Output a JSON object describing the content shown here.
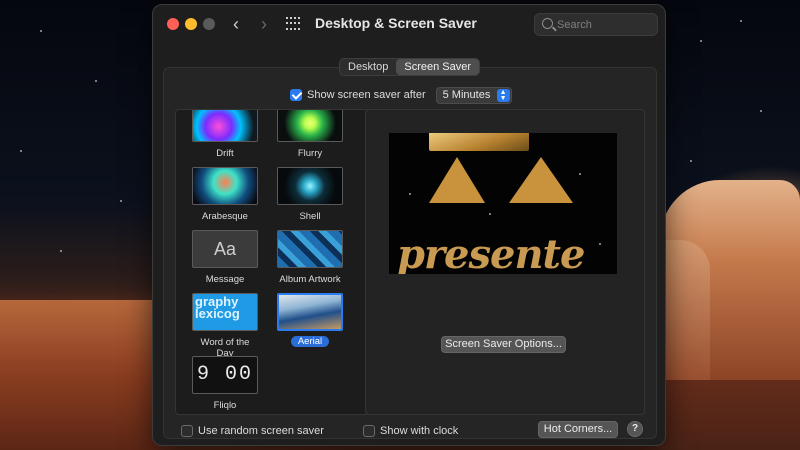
{
  "window": {
    "title": "Desktop & Screen Saver",
    "search_placeholder": "Search"
  },
  "tabs": [
    {
      "label": "Desktop",
      "active": false
    },
    {
      "label": "Screen Saver",
      "active": true
    }
  ],
  "show_after": {
    "label": "Show screen saver after",
    "checked": true,
    "value": "5 Minutes"
  },
  "screensavers": [
    {
      "name": "Drift",
      "icon": "drift-thumbnail"
    },
    {
      "name": "Flurry",
      "icon": "flurry-thumbnail"
    },
    {
      "name": "Arabesque",
      "icon": "arabesque-thumbnail"
    },
    {
      "name": "Shell",
      "icon": "shell-thumbnail"
    },
    {
      "name": "Message",
      "icon": "message-thumbnail",
      "thumb_text": "Aa"
    },
    {
      "name": "Album Artwork",
      "icon": "album-artwork-thumbnail"
    },
    {
      "name": "Word of the Day",
      "icon": "word-of-the-day-thumbnail",
      "thumb_text": "graphy lexicog"
    },
    {
      "name": "Aerial",
      "icon": "aerial-thumbnail",
      "selected": true
    },
    {
      "name": "Fliqlo",
      "icon": "fliqlo-thumbnail",
      "thumb_text": "9 00"
    }
  ],
  "preview": {
    "text": "presente"
  },
  "options_button": "Screen Saver Options...",
  "bottom": {
    "random_label": "Use random screen saver",
    "random_checked": false,
    "clock_label": "Show with clock",
    "clock_checked": false,
    "hot_corners": "Hot Corners...",
    "help": "?"
  },
  "colors": {
    "accent": "#2b7bf0",
    "window_bg": "#1e1e1e",
    "close": "#ff5f57",
    "minimize": "#febc2e"
  }
}
